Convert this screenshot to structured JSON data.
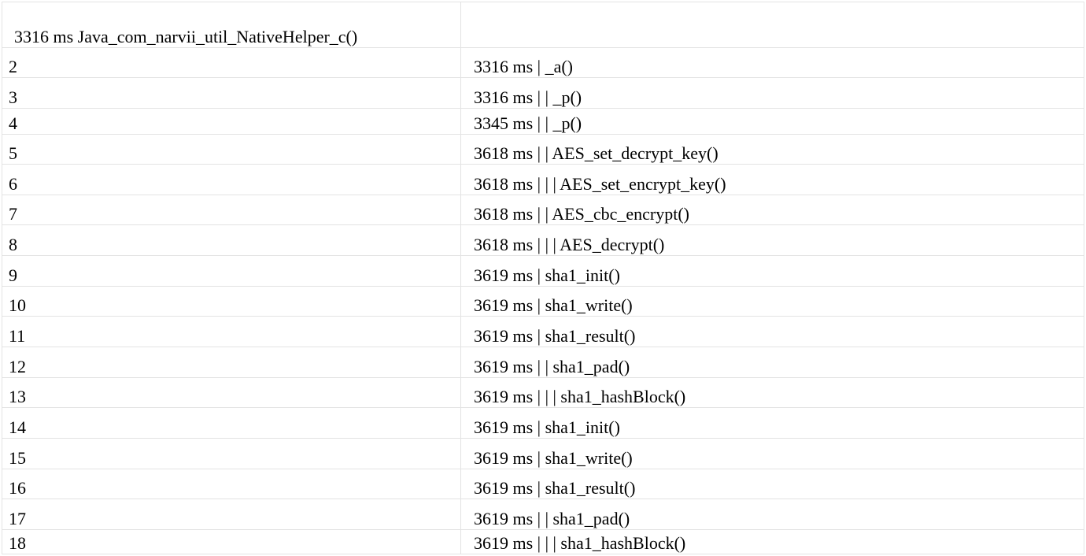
{
  "header": {
    "left": "3316 ms Java_com_narvii_util_NativeHelper_c()",
    "right": ""
  },
  "rows": [
    {
      "num": "2",
      "text": "3316 ms | _a()"
    },
    {
      "num": "3",
      "text": "3316 ms | | _p()"
    },
    {
      "num": "4",
      "text": "3345 ms | | _p()"
    },
    {
      "num": "5",
      "text": "3618 ms | | AES_set_decrypt_key()"
    },
    {
      "num": "6",
      "text": "3618 ms | | | AES_set_encrypt_key()"
    },
    {
      "num": "7",
      "text": "3618 ms | | AES_cbc_encrypt()"
    },
    {
      "num": "8",
      "text": "3618 ms | | | AES_decrypt()"
    },
    {
      "num": "9",
      "text": "3619 ms | sha1_init()"
    },
    {
      "num": "10",
      "text": "3619 ms | sha1_write()"
    },
    {
      "num": "11",
      "text": "3619 ms | sha1_result()"
    },
    {
      "num": "12",
      "text": "3619 ms | | sha1_pad()"
    },
    {
      "num": "13",
      "text": "3619 ms | | | sha1_hashBlock()"
    },
    {
      "num": "14",
      "text": "3619 ms | sha1_init()"
    },
    {
      "num": "15",
      "text": "3619 ms | sha1_write()"
    },
    {
      "num": "16",
      "text": "3619 ms | sha1_result()"
    },
    {
      "num": "17",
      "text": "3619 ms | | sha1_pad()"
    },
    {
      "num": "18",
      "text": "3619 ms | | | sha1_hashBlock()"
    }
  ]
}
